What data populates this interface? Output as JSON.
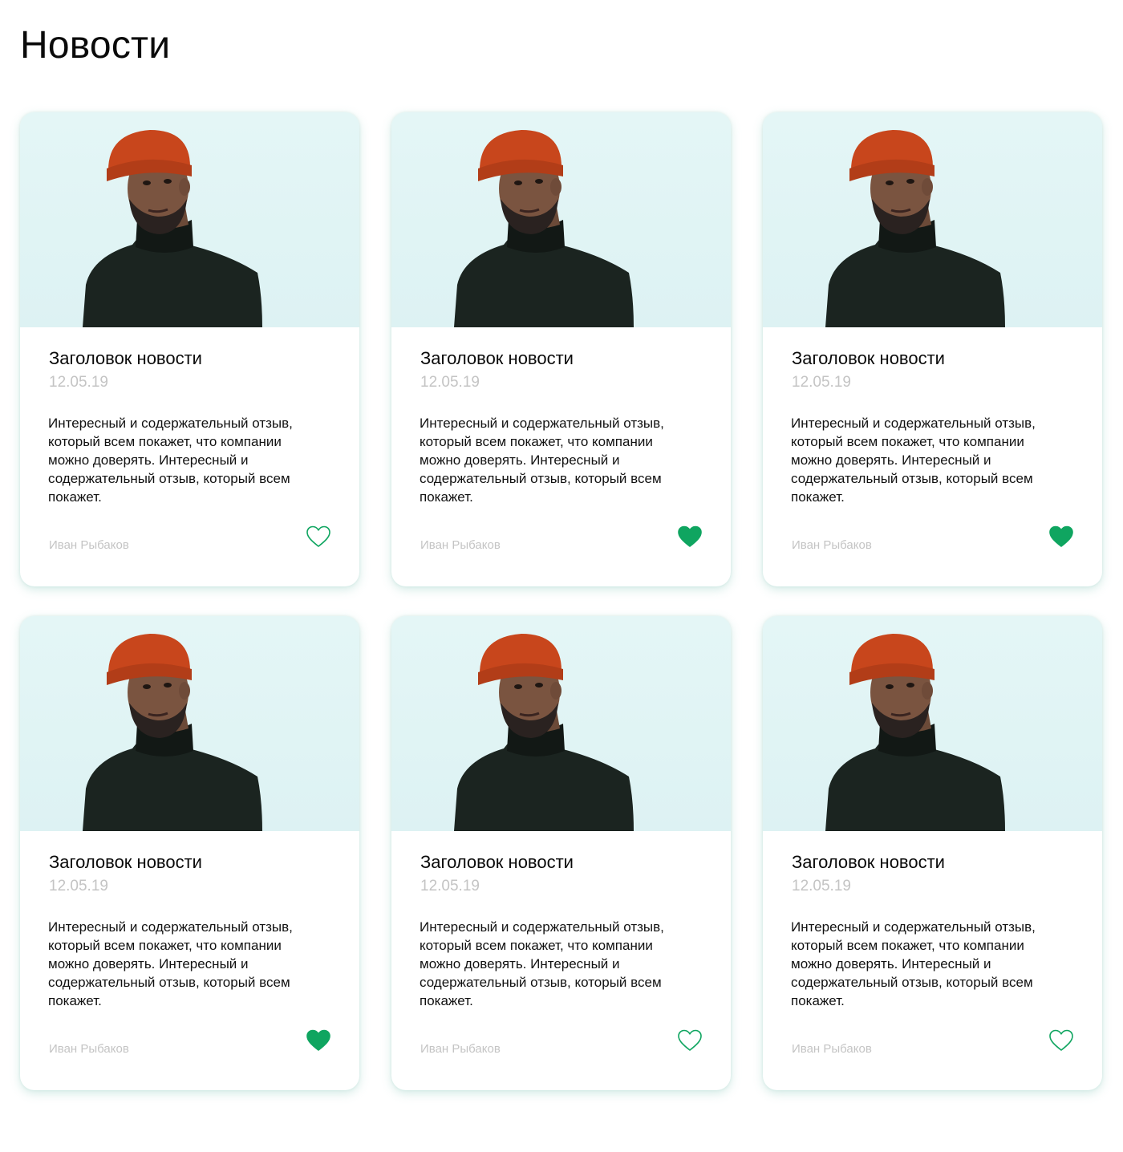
{
  "page": {
    "title": "Новости"
  },
  "theme": {
    "accent": "#0FA560",
    "muted_text": "#C4C4C4",
    "photo_background": "#DDF2F3",
    "hat": "#C8461C",
    "sweater": "#1B2420"
  },
  "news": [
    {
      "image_icon": "portrait-photo",
      "title": "Заголовок новости",
      "date": "12.05.19",
      "text": "Интересный и содержательный отзыв, который всем покажет, что компании можно доверять. Интересный и содержательный отзыв, который всем покажет.",
      "author": "Иван Рыбаков",
      "liked": false,
      "like_icon": "heart-outline-icon"
    },
    {
      "image_icon": "portrait-photo",
      "title": "Заголовок новости",
      "date": "12.05.19",
      "text": "Интересный и содержательный отзыв, который всем покажет, что компании можно доверять. Интересный и содержательный отзыв, который всем покажет.",
      "author": "Иван Рыбаков",
      "liked": true,
      "like_icon": "heart-filled-icon"
    },
    {
      "image_icon": "portrait-photo",
      "title": "Заголовок новости",
      "date": "12.05.19",
      "text": "Интересный и содержательный отзыв, который всем покажет, что компании можно доверять. Интересный и содержательный отзыв, который всем покажет.",
      "author": "Иван Рыбаков",
      "liked": true,
      "like_icon": "heart-filled-icon"
    },
    {
      "image_icon": "portrait-photo",
      "title": "Заголовок новости",
      "date": "12.05.19",
      "text": "Интересный и содержательный отзыв, который всем покажет, что компании можно доверять. Интересный и содержательный отзыв, который всем покажет.",
      "author": "Иван Рыбаков",
      "liked": true,
      "like_icon": "heart-filled-icon"
    },
    {
      "image_icon": "portrait-photo",
      "title": "Заголовок новости",
      "date": "12.05.19",
      "text": "Интересный и содержательный отзыв, который всем покажет, что компании можно доверять. Интересный и содержательный отзыв, который всем покажет.",
      "author": "Иван Рыбаков",
      "liked": false,
      "like_icon": "heart-outline-icon"
    },
    {
      "image_icon": "portrait-photo",
      "title": "Заголовок новости",
      "date": "12.05.19",
      "text": "Интересный и содержательный отзыв, который всем покажет, что компании можно доверять. Интересный и содержательный отзыв, который всем покажет.",
      "author": "Иван Рыбаков",
      "liked": false,
      "like_icon": "heart-outline-icon"
    }
  ]
}
